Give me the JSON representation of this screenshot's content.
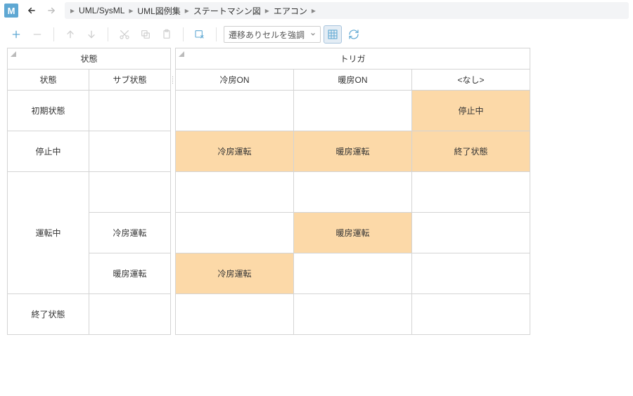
{
  "app_badge": "M",
  "breadcrumb": [
    "UML/SysML",
    "UML図例集",
    "ステートマシン図",
    "エアコン"
  ],
  "dropdown": {
    "label": "遷移ありセルを強調"
  },
  "headers": {
    "state_group": "状態",
    "trigger_group": "トリガ",
    "state": "状態",
    "substate": "サブ状態",
    "t1": "冷房ON",
    "t2": "暖房ON",
    "t3": "<なし>"
  },
  "rows": [
    {
      "state": "初期状態",
      "substate": "",
      "c1": "",
      "c2": "",
      "c3": "停止中"
    },
    {
      "state": "停止中",
      "substate": "",
      "c1": "冷房運転",
      "c2": "暖房運転",
      "c3": "終了状態"
    },
    {
      "state": "運転中",
      "substate": "",
      "c1": "",
      "c2": "",
      "c3": ""
    },
    {
      "state": "",
      "substate": "冷房運転",
      "c1": "",
      "c2": "暖房運転",
      "c3": ""
    },
    {
      "state": "",
      "substate": "暖房運転",
      "c1": "冷房運転",
      "c2": "",
      "c3": ""
    },
    {
      "state": "終了状態",
      "substate": "",
      "c1": "",
      "c2": "",
      "c3": ""
    }
  ]
}
